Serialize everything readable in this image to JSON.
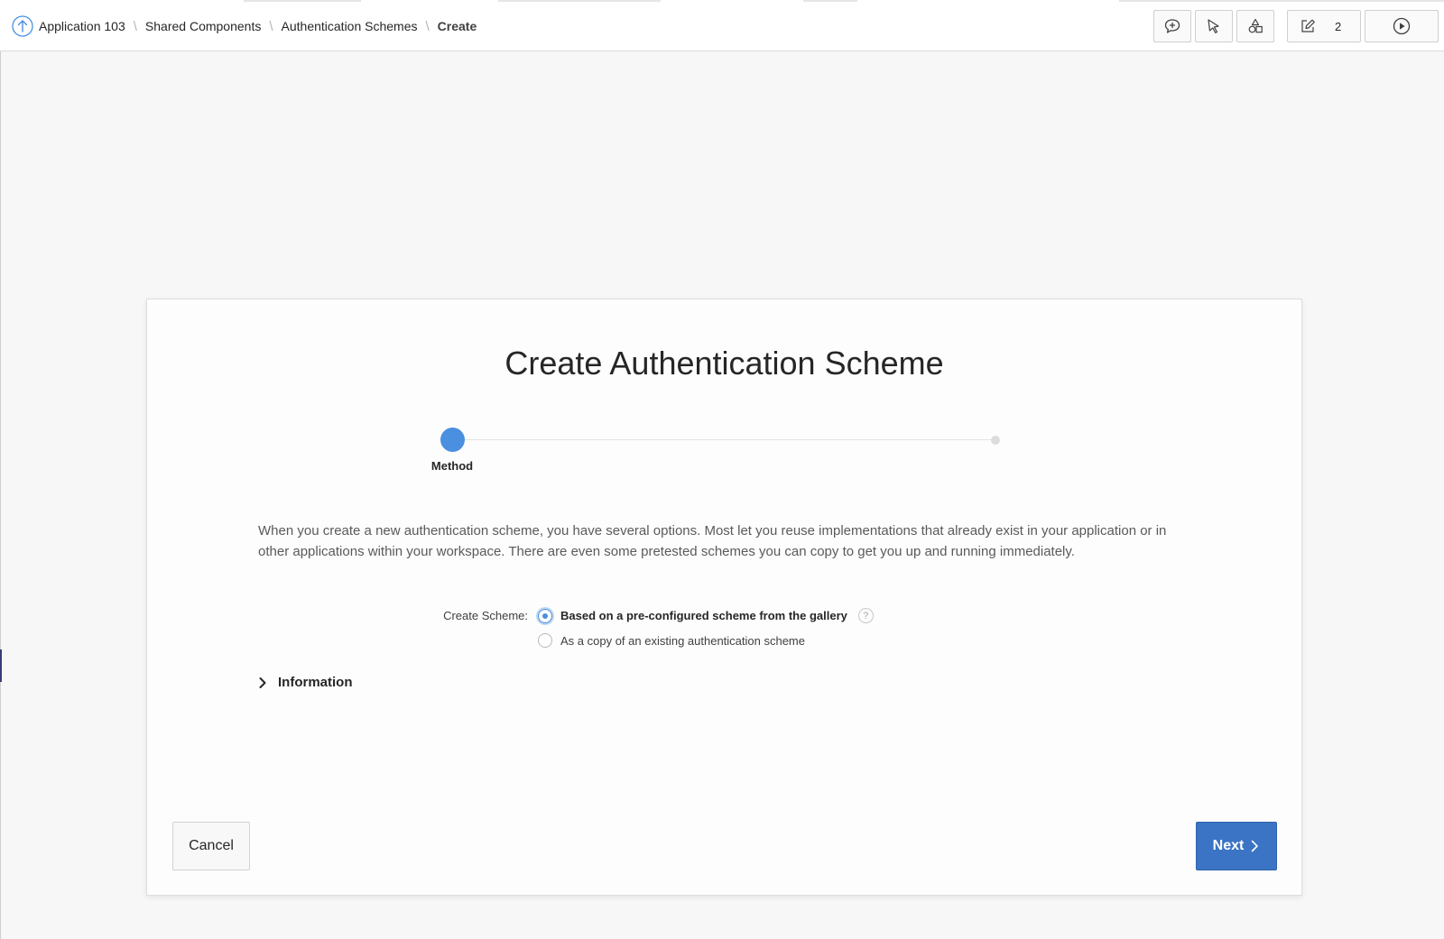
{
  "breadcrumb": {
    "items": [
      "Application 103",
      "Shared Components",
      "Authentication Schemes"
    ],
    "current": "Create",
    "separator": "\\"
  },
  "toolbar": {
    "edit_count": "2",
    "icons": [
      "comment-icon",
      "pointer-icon",
      "shapes-icon",
      "edit-icon",
      "play-icon"
    ]
  },
  "dialog": {
    "title": "Create Authentication Scheme",
    "wizard": {
      "steps": [
        "Method"
      ],
      "current_step": "Method"
    },
    "intro": "When you create a new authentication scheme, you have several options. Most let you reuse implementations that already exist in your application or in other applications within your workspace. There are even some pretested schemes you can copy to get you up and running immediately.",
    "create_scheme": {
      "label": "Create Scheme:",
      "options": [
        "Based on a pre-configured scheme from the gallery",
        "As a copy of an existing authentication scheme"
      ],
      "selected": "Based on a pre-configured scheme from the gallery",
      "help": "?"
    },
    "information_label": "Information",
    "cancel_label": "Cancel",
    "next_label": "Next"
  },
  "colors": {
    "accent": "#4a8fe0",
    "primary_button": "#3b74c4",
    "background": "#f7f7f7"
  }
}
